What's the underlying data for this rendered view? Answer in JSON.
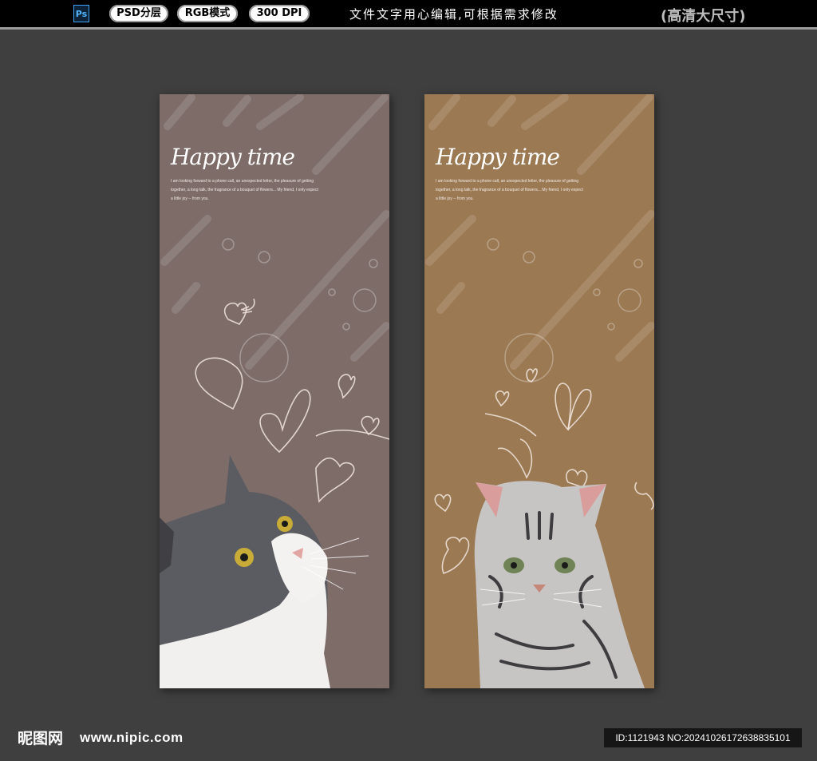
{
  "header": {
    "ps_icon_label": "Ps",
    "badges": [
      "PSD分层",
      "RGB模式",
      "300 DPI"
    ],
    "notice": "文件文字用心编辑,可根据需求修改",
    "size_label": "(高清大尺寸)"
  },
  "panels": [
    {
      "title": "Happy time",
      "body": "I am looking forward to a phone call, an unexpected letter, the pleasure of getting together, a long talk, the fragrance of a bouquet of flowers... My friend, I only expect a little joy -- from you.",
      "background": "#7d6c68",
      "photo": "grey-white-cat"
    },
    {
      "title": "Happy time",
      "body": "I am looking forward to a phone call, an unexpected letter, the pleasure of getting together, a long talk, the fragrance of a bouquet of flowers... My friend, I only expect a little joy -- from you.",
      "background": "#9b7953",
      "photo": "silver-tabby-cat"
    }
  ],
  "footer": {
    "logo": "昵图网",
    "url": "www.nipic.com",
    "id_text": "ID:1121943 NO:20241026172638835101"
  }
}
